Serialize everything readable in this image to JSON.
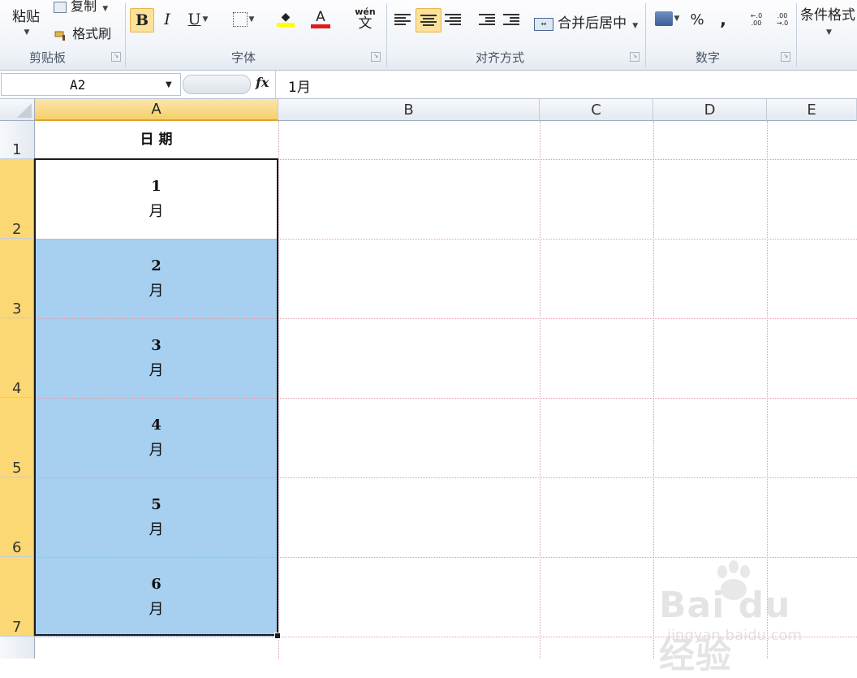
{
  "ribbon": {
    "clipboard": {
      "paste_label": "粘贴",
      "copy_label": "复制",
      "format_painter_label": "格式刷",
      "group_label": "剪贴板"
    },
    "font": {
      "bold_label": "B",
      "italic_label": "I",
      "underline_label": "U",
      "font_color_label": "A",
      "wen_label": "wén",
      "wen_char": "文",
      "group_label": "字体",
      "fill_color": "#ffff00",
      "text_color": "#e21a1a"
    },
    "alignment": {
      "merge_center_label": "合并后居中",
      "group_label": "对齐方式"
    },
    "number": {
      "percent_label": "%",
      "comma_label": ",",
      "inc_decimal_label": "←.0 .00",
      "dec_decimal_label": ".00 →.0",
      "group_label": "数字"
    },
    "styles": {
      "conditional_format_label": "条件格式"
    }
  },
  "formula_bar": {
    "name_box": "A2",
    "fx_label": "fx",
    "formula": "1月"
  },
  "sheet": {
    "columns": [
      "A",
      "B",
      "C",
      "D",
      "E"
    ],
    "selected_column": "A",
    "rows": [
      "1",
      "2",
      "3",
      "4",
      "5",
      "6",
      "7"
    ],
    "header_cell": "日 期",
    "cells": [
      {
        "num": "1",
        "unit": "月"
      },
      {
        "num": "2",
        "unit": "月"
      },
      {
        "num": "3",
        "unit": "月"
      },
      {
        "num": "4",
        "unit": "月"
      },
      {
        "num": "5",
        "unit": "月"
      },
      {
        "num": "6",
        "unit": "月"
      }
    ],
    "highlight_color": "#a6cff0"
  },
  "watermark": {
    "brand_text": "Bai du 经验",
    "url_text": "jingyan.baidu.com"
  }
}
